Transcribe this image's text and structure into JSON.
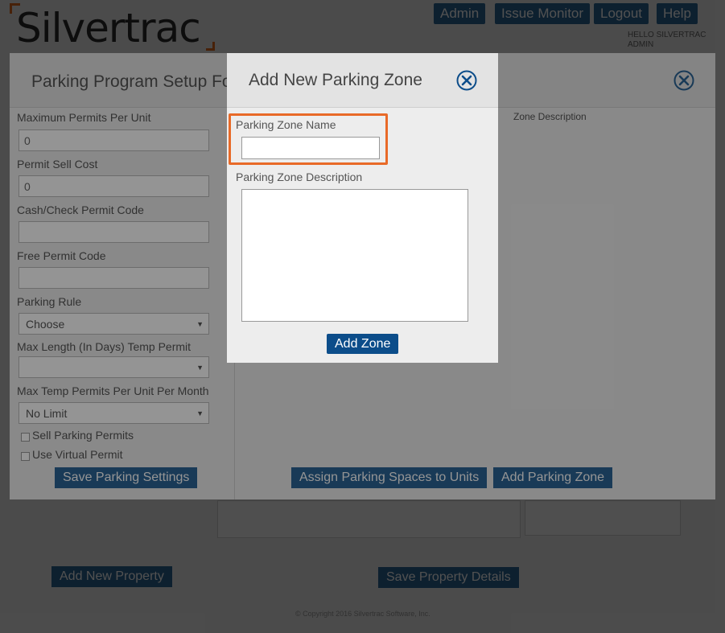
{
  "header": {
    "brand": "Silvertrac",
    "nav": [
      "Admin",
      "Issue Monitor",
      "Logout",
      "Help"
    ],
    "meta_right_1": "HELLO SILVERTRAC",
    "meta_right_2": "ADMIN"
  },
  "background_page": {
    "add_property_label": "Add New Property",
    "save_details_label": "Save Property Details",
    "footer": "© Copyright 2016 Silvertrac Software, Inc."
  },
  "setup_modal": {
    "title": "Parking Program Setup Form",
    "fields": {
      "max_permits_label": "Maximum Permits Per Unit",
      "max_permits_value": "0",
      "sell_cost_label": "Permit Sell Cost",
      "sell_cost_value": "0",
      "cash_code_label": "Cash/Check Permit Code",
      "free_code_label": "Free Permit Code",
      "rule_label": "Parking Rule",
      "rule_value": "Choose",
      "max_length_label": "Max Length (In Days) Temp Permit",
      "max_length_value": "",
      "max_temp_label": "Max Temp Permits Per Unit Per Month",
      "max_temp_value": "No Limit",
      "sell_permits_label": "Sell Parking Permits",
      "virtual_permit_label": "Use Virtual Permit"
    },
    "save_settings_label": "Save Parking Settings",
    "zone_column_header": "Zone Description",
    "assign_spaces_label": "Assign Parking Spaces to Units",
    "add_zone_label": "Add Parking Zone"
  },
  "zone_modal": {
    "title": "Add New Parking Zone",
    "name_label": "Parking Zone Name",
    "name_value": "",
    "description_label": "Parking Zone Description",
    "description_value": "",
    "submit_label": "Add Zone"
  },
  "colors": {
    "accent_blue": "#2c6496",
    "button_dark_blue": "#0c4d8a",
    "highlight_orange": "#e86a28"
  }
}
